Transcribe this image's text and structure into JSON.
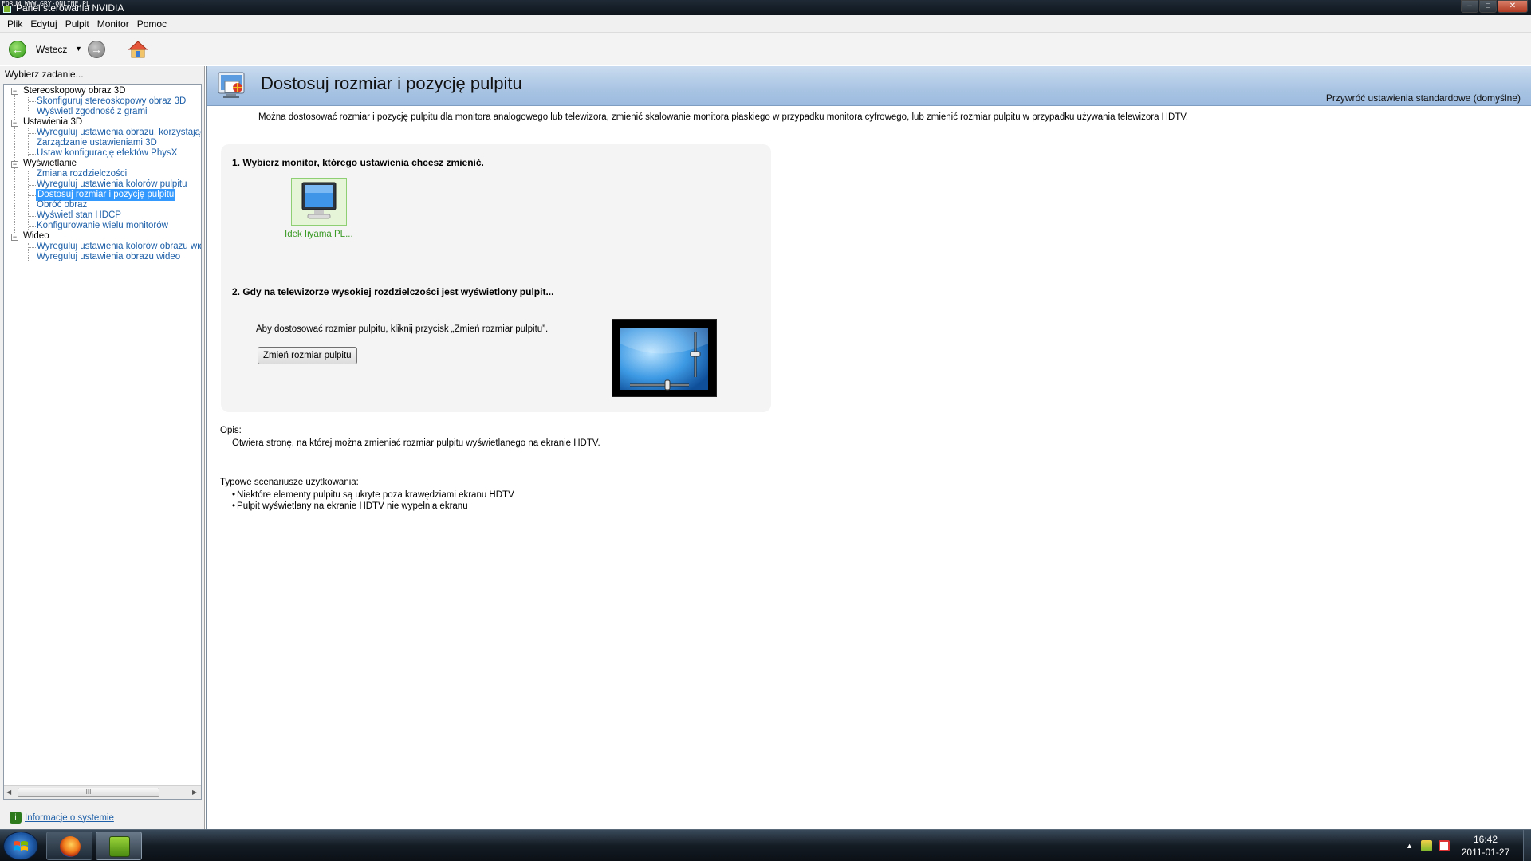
{
  "window": {
    "watermark": "FORUM WWW.GRY-ONLINE.PL",
    "title": "Panel sterowania NVIDIA",
    "buttons": {
      "minimize": "–",
      "maximize": "□",
      "close": "✕"
    }
  },
  "menu": [
    "Plik",
    "Edytuj",
    "Pulpit",
    "Monitor",
    "Pomoc"
  ],
  "toolbar": {
    "back_label": "Wstecz",
    "dropdown": "▼"
  },
  "sidebar": {
    "task_label": "Wybierz zadanie...",
    "tree": [
      {
        "label": "Stereoskopowy obraz 3D",
        "expander": "−",
        "items": [
          "Skonfiguruj stereoskopowy obraz 3D",
          "Wyświetl zgodność z grami"
        ]
      },
      {
        "label": "Ustawienia 3D",
        "expander": "−",
        "items": [
          "Wyreguluj ustawienia obrazu, korzystając z podglądu",
          "Zarządzanie ustawieniami 3D",
          "Ustaw konfigurację efektów PhysX"
        ]
      },
      {
        "label": "Wyświetlanie",
        "expander": "−",
        "items": [
          "Zmiana rozdzielczości",
          "Wyreguluj ustawienia kolorów pulpitu",
          "Dostosuj rozmiar i pozycję pulpitu",
          "Obróć obraz",
          "Wyświetl stan HDCP",
          "Konfigurowanie wielu monitorów"
        ]
      },
      {
        "label": "Wideo",
        "expander": "−",
        "items": [
          "Wyreguluj ustawienia kolorów obrazu wideo",
          "Wyreguluj ustawienia obrazu wideo"
        ]
      }
    ],
    "selected": "Dostosuj rozmiar i pozycję pulpitu",
    "scroll": {
      "left": "◀",
      "right": "▶",
      "thumb": "III"
    },
    "system_info": "Informacje o systemie"
  },
  "content": {
    "title": "Dostosuj rozmiar i pozycję pulpitu",
    "restore": "Przywróć ustawienia standardowe (domyślne)",
    "intro": "Można dostosować rozmiar i pozycję pulpitu dla monitora analogowego lub telewizora, zmienić skalowanie monitora płaskiego w przypadku monitora cyfrowego, lub zmienić rozmiar pulpitu w przypadku używania telewizora HDTV.",
    "step1": "1. Wybierz monitor, którego ustawienia chcesz zmienić.",
    "monitor_name": "Idek Iiyama PL...",
    "step2": "2. Gdy na telewizorze wysokiej rozdzielczości jest wyświetlony pulpit...",
    "hdtv_instruction": "Aby dostosować rozmiar pulpitu, kliknij przycisk „Zmień rozmiar pulpitu”.",
    "resize_button": "Zmień rozmiar pulpitu",
    "desc_label": "Opis:",
    "desc_text": "Otwiera stronę, na której można zmieniać rozmiar pulpitu wyświetlanego na ekranie HDTV.",
    "scenarios_label": "Typowe scenariusze użytkowania:",
    "scenarios": [
      "Niektóre elementy pulpitu są ukryte poza krawędziami ekranu HDTV",
      "Pulpit wyświetlany na ekranie HDTV nie wypełnia ekranu"
    ]
  },
  "taskbar": {
    "tray_arrow": "▲",
    "time": "16:42",
    "date": "2011-01-27"
  },
  "colors": {
    "accent": "#3399ff",
    "link": "#1d5fa8",
    "nvidia_green": "#76b900",
    "banner": "#a9c4e3"
  },
  "icons": [
    "back-arrow-icon",
    "forward-arrow-icon",
    "home-icon",
    "monitor-icon",
    "hdtv-resize-icon",
    "system-info-icon",
    "windows-start-icon",
    "firefox-icon",
    "nvidia-icon"
  ]
}
